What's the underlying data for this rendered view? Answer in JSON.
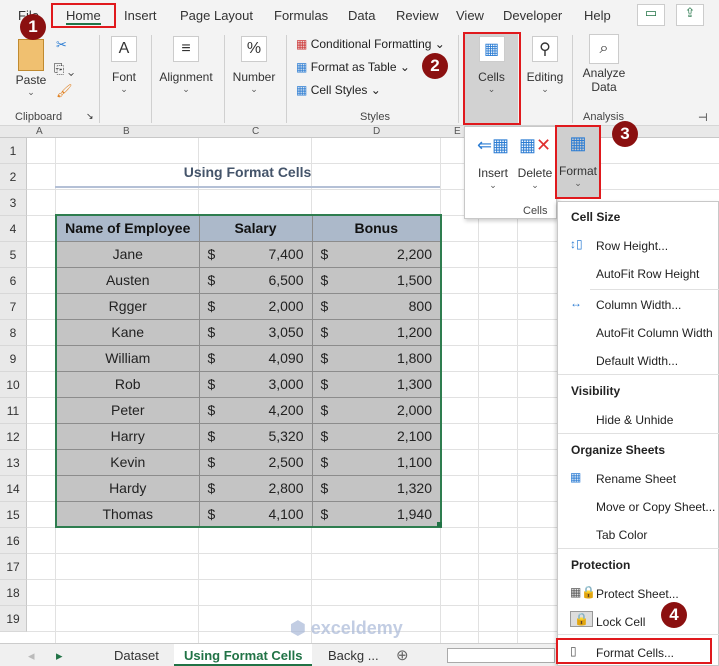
{
  "ribbon_tabs": [
    "File",
    "Home",
    "Insert",
    "Page Layout",
    "Formulas",
    "Data",
    "Review",
    "View",
    "Developer",
    "Help"
  ],
  "ribbon": {
    "clipboard": {
      "paste": "Paste",
      "label": "Clipboard"
    },
    "font": "Font",
    "alignment": "Alignment",
    "number": "Number",
    "styles": {
      "conditional": "Conditional Formatting",
      "format_table": "Format as Table",
      "cell_styles": "Cell Styles",
      "label": "Styles"
    },
    "cells": "Cells",
    "editing": "Editing",
    "analyze": "Analyze Data",
    "analysis_label": "Analysis"
  },
  "cells_panel": {
    "insert": "Insert",
    "delete": "Delete",
    "format": "Format",
    "label": "Cells"
  },
  "columns": [
    "A",
    "B",
    "C",
    "D",
    "E"
  ],
  "rows": [
    "1",
    "2",
    "3",
    "4",
    "5",
    "6",
    "7",
    "8",
    "9",
    "10",
    "11",
    "12",
    "13",
    "14",
    "15",
    "16",
    "17",
    "18",
    "19"
  ],
  "sheet": {
    "title": "Using Format Cells",
    "headers": [
      "Name of Employee",
      "Salary",
      "Bonus"
    ],
    "currency": "$",
    "data": [
      [
        "Jane",
        "7,400",
        "2,200"
      ],
      [
        "Austen",
        "6,500",
        "1,500"
      ],
      [
        "Rgger",
        "2,000",
        "800"
      ],
      [
        "Kane",
        "3,050",
        "1,200"
      ],
      [
        "William",
        "4,090",
        "1,800"
      ],
      [
        "Rob",
        "3,000",
        "1,300"
      ],
      [
        "Peter",
        "4,200",
        "2,000"
      ],
      [
        "Harry",
        "5,320",
        "2,100"
      ],
      [
        "Kevin",
        "2,500",
        "1,100"
      ],
      [
        "Hardy",
        "2,800",
        "1,320"
      ],
      [
        "Thomas",
        "4,100",
        "1,940"
      ]
    ]
  },
  "format_menu": {
    "cell_size": "Cell Size",
    "row_height": "Row Height...",
    "autofit_row": "AutoFit Row Height",
    "column_width": "Column Width...",
    "autofit_column": "AutoFit Column Width",
    "default_width": "Default Width...",
    "visibility": "Visibility",
    "hide_unhide": "Hide & Unhide",
    "organize": "Organize Sheets",
    "rename": "Rename Sheet",
    "move_copy": "Move or Copy Sheet...",
    "tab_color": "Tab Color",
    "protection": "Protection",
    "protect_sheet": "Protect Sheet...",
    "lock_cell": "Lock Cell",
    "format_cells": "Format Cells..."
  },
  "sheet_tabs": [
    "Dataset",
    "Using Format Cells",
    "Backg ..."
  ],
  "steps": [
    "1",
    "2",
    "3",
    "4"
  ],
  "watermark": "exceldemy EXCEL · DATA · BI",
  "colors": {
    "accent": "#217346",
    "highlight": "#e0191d",
    "badge": "#8b1010",
    "header_fill": "#acb9ca",
    "cell_fill": "#c4c4c4"
  }
}
